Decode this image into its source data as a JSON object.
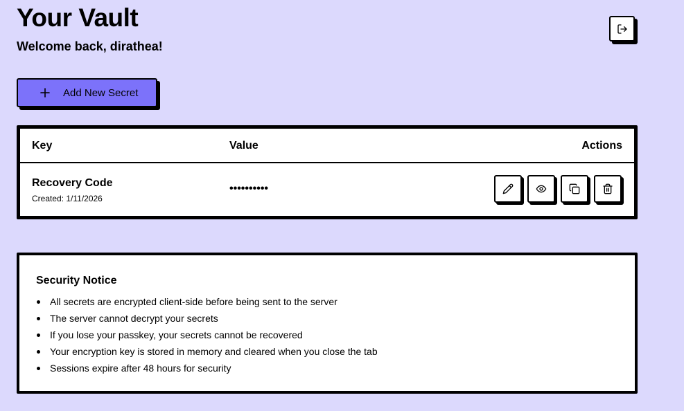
{
  "header": {
    "title": "Your Vault",
    "welcome": "Welcome back, dirathea!",
    "logout_icon": "logout-icon"
  },
  "toolbar": {
    "add_label": "Add New Secret",
    "add_icon": "plus-icon"
  },
  "table": {
    "columns": {
      "key": "Key",
      "value": "Value",
      "actions": "Actions"
    },
    "rows": [
      {
        "name": "Recovery Code",
        "created": "Created: 1/11/2026",
        "value": "••••••••••",
        "actions": [
          "edit-icon",
          "eye-icon",
          "copy-icon",
          "trash-icon"
        ]
      }
    ]
  },
  "notice": {
    "title": "Security Notice",
    "items": [
      "All secrets are encrypted client-side before being sent to the server",
      "The server cannot decrypt your secrets",
      "If you lose your passkey, your secrets cannot be recovered",
      "Your encryption key is stored in memory and cleared when you close the tab",
      "Sessions expire after 48 hours for security"
    ]
  },
  "colors": {
    "background": "#dcd9fd",
    "accent": "#7c72fa",
    "border": "#000000",
    "surface": "#ffffff"
  }
}
